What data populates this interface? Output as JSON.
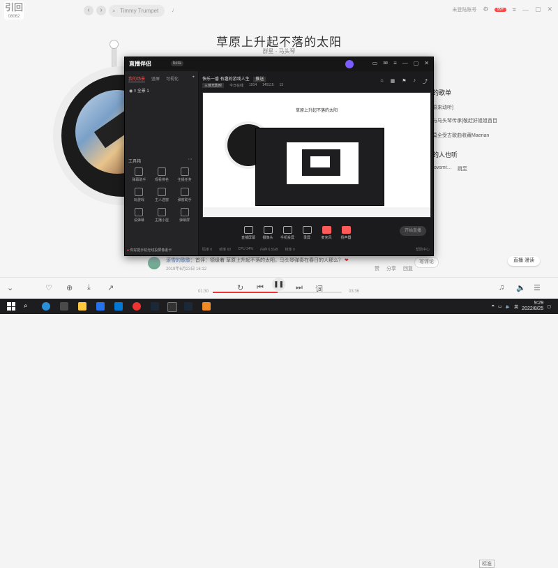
{
  "music": {
    "logo": "引回",
    "logo_sub": "08062",
    "search_value": "Timmy Trumpet",
    "account_label": "未登陆账号",
    "vip_badge": "99+",
    "song_title": "草原上升起不落的太阳",
    "song_artist": "群星 - 马头琴",
    "right_panel": {
      "heading1": "的歌单",
      "list1": [
        "原来动听]",
        "与马头琴传承]敬赶好姐姐首目",
        "莫全受古歌曲收藏Maerian"
      ],
      "heading2": "的人也听",
      "list2": [
        "ovsmt…",
        "跳至"
      ]
    },
    "comment": {
      "user": "滚雪的歌歌",
      "text": "首评：德级着 草原上升起不落的太阳，马头琴弹奏在春日的人那么？",
      "date": "2019年6月23日 16:12",
      "reply_button": "写评论"
    },
    "comment_actions": [
      "赞",
      "分享",
      "回复"
    ],
    "live_pill": "直播 漫读",
    "player": {
      "time_current": "01:30",
      "time_total": "03:36",
      "progress_fraction": 0.5,
      "lyric_label": "词",
      "quality_label": "标准"
    }
  },
  "live_window": {
    "app_name": "直播伴侣",
    "version": "beta",
    "tabs": [
      "我的场景",
      "竖屏",
      "可视化"
    ],
    "scene_name": "全景 1",
    "tools_heading": "工具箱",
    "tools": [
      "弹幕助手",
      "观看排名",
      "主播任务",
      "玩游戏",
      "主人选窗",
      "弹窗助手",
      "设弹幕",
      "主播小屋",
      "弹幕屏"
    ],
    "bottom_tip": "你好把手机无线投屏像素卡",
    "channel": "快乐一番 有趣的游戏人生",
    "channel_tag": "推送",
    "stats": {
      "pill": "三体光影时",
      "online": "今日在线",
      "likes": "1914",
      "viewers": "145115",
      "count": "13"
    },
    "preview_title": "草原上升起不落的太阳",
    "toolbar": [
      "直播屏幕",
      "摄像头",
      "手机投屏",
      "录屏",
      "麦克风",
      "扬声器"
    ],
    "go_live_label": "开始直播",
    "footer": [
      "码率 0",
      "帧率 60",
      "CPU 34%",
      "内存 6.5GB",
      "帧率 0"
    ],
    "foot_right": "帮助中心"
  },
  "taskbar": {
    "time": "9:29",
    "date": "2022/8/25",
    "lang": "英"
  }
}
